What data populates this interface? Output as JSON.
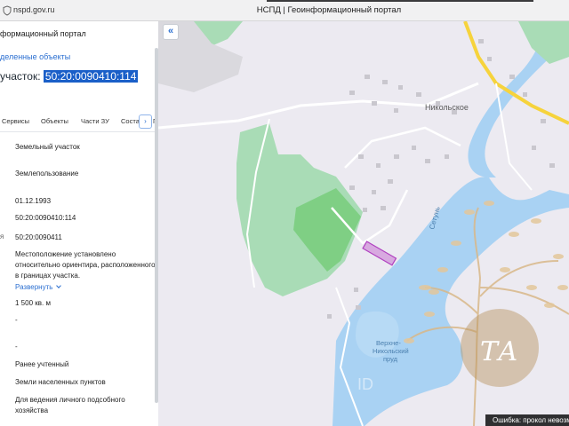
{
  "browser": {
    "url": "nspd.gov.ru",
    "tab_title": "НСПД | Геоинформационный портал"
  },
  "panel": {
    "portal_title": "формационный портал",
    "back_link": "деленные объекты",
    "parcel_prefix": "участок: ",
    "parcel_number": "50:20:0090410:114",
    "tabs": [
      "Сервисы",
      "Объекты",
      "Части ЗУ",
      "Соста",
      "Г"
    ],
    "rows": [
      {
        "label": "",
        "value": "Земельный участок"
      },
      {
        "label": "",
        "value": "Землепользование"
      },
      {
        "label": "",
        "value": "01.12.1993"
      },
      {
        "label": "",
        "value": "50:20:0090410:114"
      },
      {
        "label": "я",
        "value": "50:20:0090411"
      },
      {
        "label": "",
        "value": "Местоположение установлено относительно ориентира, расположенного в границах участка."
      },
      {
        "label": "",
        "value": "1 500 кв. м"
      },
      {
        "label": "",
        "value": "-"
      },
      {
        "label": "",
        "value": "-"
      },
      {
        "label": "",
        "value": "Ранее учтенный"
      },
      {
        "label": "",
        "value": "Земли населенных пунктов"
      },
      {
        "label": "",
        "value": "Для ведения личного подсобного хозяйства"
      }
    ],
    "expand_label": "Развернуть"
  },
  "map": {
    "labels": {
      "village": "Никольское",
      "river": "Сетунь",
      "pond": "Верхне-\nНикольский\nпруд",
      "watermark_initials": "ТА",
      "watermark_id": "ID"
    },
    "error_text": "Ошибка: прокол невозмож"
  },
  "colors": {
    "accent": "#2b6fd1",
    "selection": "#1a5fc8",
    "water": "#a9d2f3",
    "forest": "#a9dcb6",
    "park": "#7fcf84",
    "road_major": "#f6d33c",
    "parcel_fill": "#d8a9e0",
    "parcel_stroke": "#b040c0"
  },
  "icons": {
    "url_lock": "lock-icon",
    "collapse": "double-chevron-left-icon",
    "tabs_next": "chevron-right-icon",
    "expand": "chevron-down-icon"
  }
}
